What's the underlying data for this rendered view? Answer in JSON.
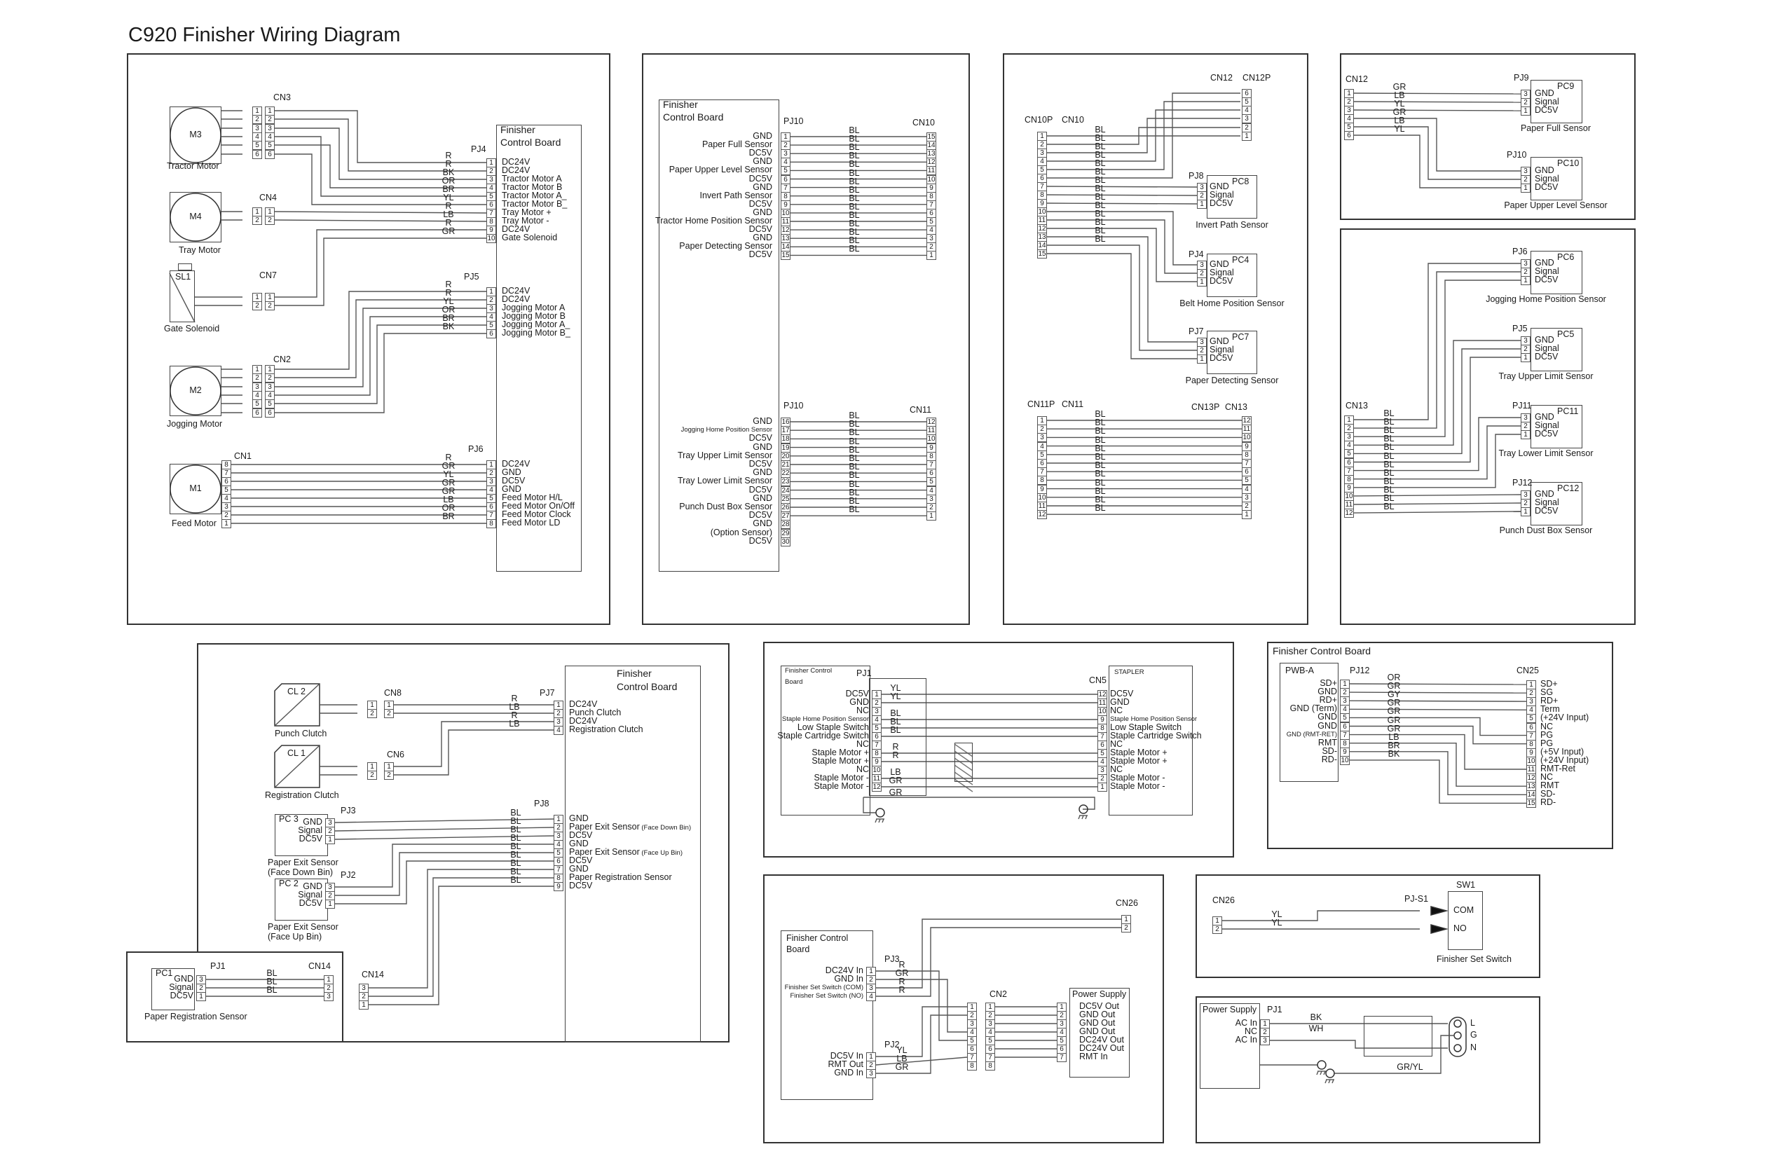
{
  "title": "C920 Finisher Wiring Diagram",
  "panel_motors": {
    "board_label": "Finisher Control Board",
    "components": [
      {
        "id": "M3",
        "name": "Tractor Motor",
        "connector": "CN3",
        "pins": 6
      },
      {
        "id": "M4",
        "name": "Tray Motor",
        "connector": "CN4",
        "pins": 2
      },
      {
        "id": "SL1",
        "name": "Gate Solenoid",
        "connector": "CN7",
        "pins": 2
      },
      {
        "id": "M2",
        "name": "Jogging Motor",
        "connector": "CN2",
        "pins": 6
      },
      {
        "id": "M1",
        "name": "Feed Motor",
        "connector": "CN1",
        "pins": 8
      }
    ],
    "pj4": {
      "label": "PJ4",
      "rows": [
        {
          "pin": "1",
          "color": "R",
          "signal": "DC24V"
        },
        {
          "pin": "2",
          "color": "R",
          "signal": "DC24V"
        },
        {
          "pin": "3",
          "color": "BK",
          "signal": "Tractor Motor A"
        },
        {
          "pin": "4",
          "color": "OR",
          "signal": "Tractor Motor B"
        },
        {
          "pin": "5",
          "color": "BR",
          "signal": "Tractor Motor A_"
        },
        {
          "pin": "6",
          "color": "YL",
          "signal": "Tractor Motor B_"
        },
        {
          "pin": "7",
          "color": "R",
          "signal": "Tray Motor +"
        },
        {
          "pin": "8",
          "color": "LB",
          "signal": "Tray Motor -"
        },
        {
          "pin": "9",
          "color": "R",
          "signal": "DC24V"
        },
        {
          "pin": "10",
          "color": "GR",
          "signal": "Gate Solenoid"
        }
      ]
    },
    "pj5": {
      "label": "PJ5",
      "rows": [
        {
          "pin": "1",
          "color": "R",
          "signal": "DC24V"
        },
        {
          "pin": "2",
          "color": "R",
          "signal": "DC24V"
        },
        {
          "pin": "3",
          "color": "YL",
          "signal": "Jogging Motor A"
        },
        {
          "pin": "4",
          "color": "OR",
          "signal": "Jogging Motor B"
        },
        {
          "pin": "5",
          "color": "BR",
          "signal": "Jogging Motor A_"
        },
        {
          "pin": "6",
          "color": "BK",
          "signal": "Jogging Motor B_"
        }
      ]
    },
    "pj6": {
      "label": "PJ6",
      "rows": [
        {
          "pin": "1",
          "color": "R",
          "signal": "DC24V"
        },
        {
          "pin": "2",
          "color": "GR",
          "signal": "GND"
        },
        {
          "pin": "3",
          "color": "YL",
          "signal": "DC5V"
        },
        {
          "pin": "4",
          "color": "GR",
          "signal": "GND"
        },
        {
          "pin": "5",
          "color": "GR",
          "signal": "Feed Motor H/L"
        },
        {
          "pin": "6",
          "color": "LB",
          "signal": "Feed Motor On/Off"
        },
        {
          "pin": "7",
          "color": "OR",
          "signal": "Feed Motor Clock"
        },
        {
          "pin": "8",
          "color": "BR",
          "signal": "Feed Motor LD"
        }
      ]
    }
  },
  "panel_pj10": {
    "board_label": "Finisher Control Board",
    "upper": {
      "pj": "PJ10",
      "cn": "CN10",
      "rows": [
        {
          "pin": "1",
          "signal": "GND",
          "color": "BL",
          "cn_pin": "15"
        },
        {
          "pin": "2",
          "signal": "Paper Full Sensor",
          "color": "BL",
          "cn_pin": "14"
        },
        {
          "pin": "3",
          "signal": "DC5V",
          "color": "BL",
          "cn_pin": "13"
        },
        {
          "pin": "4",
          "signal": "GND",
          "color": "BL",
          "cn_pin": "12"
        },
        {
          "pin": "5",
          "signal": "Paper Upper Level Sensor",
          "color": "BL",
          "cn_pin": "11"
        },
        {
          "pin": "6",
          "signal": "DC5V",
          "color": "BL",
          "cn_pin": "10"
        },
        {
          "pin": "7",
          "signal": "GND",
          "color": "BL",
          "cn_pin": "9"
        },
        {
          "pin": "8",
          "signal": "Invert Path Sensor",
          "color": "BL",
          "cn_pin": "8"
        },
        {
          "pin": "9",
          "signal": "DC5V",
          "color": "BL",
          "cn_pin": "7"
        },
        {
          "pin": "10",
          "signal": "GND",
          "color": "BL",
          "cn_pin": "6"
        },
        {
          "pin": "11",
          "signal": "Tractor Home Position Sensor",
          "color": "BL",
          "cn_pin": "5"
        },
        {
          "pin": "12",
          "signal": "DC5V",
          "color": "BL",
          "cn_pin": "4"
        },
        {
          "pin": "13",
          "signal": "GND",
          "color": "BL",
          "cn_pin": "3"
        },
        {
          "pin": "14",
          "signal": "Paper Detecting Sensor",
          "color": "BL",
          "cn_pin": "2"
        },
        {
          "pin": "15",
          "signal": "DC5V",
          "color": "BL",
          "cn_pin": "1"
        }
      ]
    },
    "lower": {
      "pj": "PJ10",
      "cn": "CN11",
      "rows": [
        {
          "pin": "16",
          "signal": "GND",
          "color": "BL",
          "cn_pin": "12"
        },
        {
          "pin": "17",
          "signal": "Jogging Home Position Sensor",
          "color": "BL",
          "cn_pin": "11"
        },
        {
          "pin": "18",
          "signal": "DC5V",
          "color": "BL",
          "cn_pin": "10"
        },
        {
          "pin": "19",
          "signal": "GND",
          "color": "BL",
          "cn_pin": "9"
        },
        {
          "pin": "20",
          "signal": "Tray Upper Limit Sensor",
          "color": "BL",
          "cn_pin": "8"
        },
        {
          "pin": "21",
          "signal": "DC5V",
          "color": "BL",
          "cn_pin": "7"
        },
        {
          "pin": "22",
          "signal": "GND",
          "color": "BL",
          "cn_pin": "6"
        },
        {
          "pin": "23",
          "signal": "Tray Lower Limit Sensor",
          "color": "BL",
          "cn_pin": "5"
        },
        {
          "pin": "24",
          "signal": "DC5V",
          "color": "BL",
          "cn_pin": "4"
        },
        {
          "pin": "25",
          "signal": "GND",
          "color": "BL",
          "cn_pin": "3"
        },
        {
          "pin": "26",
          "signal": "Punch Dust Box Sensor",
          "color": "BL",
          "cn_pin": "2"
        },
        {
          "pin": "27",
          "signal": "DC5V",
          "color": "BL",
          "cn_pin": "1"
        },
        {
          "pin": "28",
          "signal": "GND",
          "color": "",
          "cn_pin": ""
        },
        {
          "pin": "29",
          "signal": "(Option Sensor)",
          "color": "",
          "cn_pin": ""
        },
        {
          "pin": "30",
          "signal": "DC5V",
          "color": "",
          "cn_pin": ""
        }
      ]
    }
  },
  "panel_cn10": {
    "labels": [
      "CN10P",
      "CN10",
      "CN12",
      "CN12P",
      "CN11P",
      "CN11",
      "CN13P",
      "CN13"
    ],
    "wire_color": "BL",
    "sensors": [
      {
        "pj": "PJ8",
        "pc": "PC8",
        "name": "Invert Path Sensor"
      },
      {
        "pj": "PJ4",
        "pc": "PC4",
        "name": "Belt Home Position Sensor"
      },
      {
        "pj": "PJ7",
        "pc": "PC7",
        "name": "Paper Detecting Sensor"
      }
    ],
    "sensor_pins": [
      "GND",
      "Signal",
      "DC5V"
    ]
  },
  "panel_cn12": {
    "cn": "CN12",
    "colors": [
      "GR",
      "LB",
      "YL",
      "GR",
      "LB",
      "YL"
    ],
    "sensors": [
      {
        "pj": "PJ9",
        "pc": "PC9",
        "name": "Paper Full Sensor"
      },
      {
        "pj": "PJ10",
        "pc": "PC10",
        "name": "Paper Upper Level Sensor"
      }
    ]
  },
  "panel_cn13": {
    "cn": "CN13",
    "wire_color": "BL",
    "sensors": [
      {
        "pj": "PJ6",
        "pc": "PC6",
        "name": "Jogging Home Position Sensor"
      },
      {
        "pj": "PJ5",
        "pc": "PC5",
        "name": "Tray Upper Limit Sensor"
      },
      {
        "pj": "PJ11",
        "pc": "PC11",
        "name": "Tray Lower Limit Sensor"
      },
      {
        "pj": "PJ12",
        "pc": "PC12",
        "name": "Punch Dust Box Sensor"
      }
    ]
  },
  "panel_clutch": {
    "board_label_1": "Finisher",
    "board_label_2": "Control Board",
    "clutches": [
      {
        "id": "CL 2",
        "name": "Punch Clutch",
        "cn": "CN8"
      },
      {
        "id": "CL 1",
        "name": "Registration Clutch",
        "cn": "CN6"
      }
    ],
    "pj7": {
      "label": "PJ7",
      "rows": [
        {
          "pin": "1",
          "color": "R",
          "signal": "DC24V"
        },
        {
          "pin": "2",
          "color": "LB",
          "signal": "Punch Clutch"
        },
        {
          "pin": "3",
          "color": "R",
          "signal": "DC24V"
        },
        {
          "pin": "4",
          "color": "LB",
          "signal": "Registration Clutch"
        }
      ]
    },
    "pj8": {
      "label": "PJ8",
      "rows": [
        {
          "pin": "1",
          "color": "BL",
          "signal": "GND",
          "note": ""
        },
        {
          "pin": "2",
          "color": "BL",
          "signal": "Paper Exit Sensor",
          "note": "(Face Down Bin)"
        },
        {
          "pin": "3",
          "color": "BL",
          "signal": "DC5V",
          "note": ""
        },
        {
          "pin": "4",
          "color": "BL",
          "signal": "GND",
          "note": ""
        },
        {
          "pin": "5",
          "color": "BL",
          "signal": "Paper Exit Sensor",
          "note": "(Face Up Bin)"
        },
        {
          "pin": "6",
          "color": "BL",
          "signal": "DC5V",
          "note": ""
        },
        {
          "pin": "7",
          "color": "BL",
          "signal": "GND",
          "note": ""
        },
        {
          "pin": "8",
          "color": "BL",
          "signal": "Paper Registration Sensor",
          "note": ""
        },
        {
          "pin": "9",
          "color": "BL",
          "signal": "DC5V",
          "note": ""
        }
      ]
    },
    "sensors": [
      {
        "pc": "PC 3",
        "pj": "PJ3",
        "name1": "Paper Exit Sensor",
        "name2": "(Face Down Bin)"
      },
      {
        "pc": "PC 2",
        "pj": "PJ2",
        "name1": "Paper Exit Sensor",
        "name2": "(Face Up Bin)"
      }
    ],
    "sensor_pins": [
      {
        "n": "3",
        "l": "GND"
      },
      {
        "n": "2",
        "l": "Signal"
      },
      {
        "n": "1",
        "l": "DC5V"
      }
    ],
    "cn14": "CN14"
  },
  "panel_pc1": {
    "pc": "PC1",
    "pj": "PJ1",
    "cn": "CN14",
    "name": "Paper Registration Sensor",
    "rows": [
      {
        "pin": "3",
        "signal": "GND",
        "color": "BL",
        "cn_pin": "1"
      },
      {
        "pin": "2",
        "signal": "Signal",
        "color": "BL",
        "cn_pin": "2"
      },
      {
        "pin": "1",
        "signal": "DC5V",
        "color": "BL",
        "cn_pin": "3"
      }
    ]
  },
  "panel_stapler": {
    "board_label_1": "Finisher Control",
    "board_label_2": "Board",
    "pj": "PJ1",
    "cn": "CN5",
    "stapler": "STAPLER",
    "rows": [
      {
        "pin": "1",
        "signal": "DC5V",
        "color": "YL",
        "cn_pin": "12",
        "cn_signal": "DC5V"
      },
      {
        "pin": "2",
        "signal": "GND",
        "color": "YL",
        "cn_pin": "11",
        "cn_signal": "GND"
      },
      {
        "pin": "3",
        "signal": "NC",
        "color": "",
        "cn_pin": "10",
        "cn_signal": "NC"
      },
      {
        "pin": "4",
        "signal": "Staple Home Position Sensor",
        "color": "BL",
        "cn_pin": "9",
        "cn_signal": "Staple Home Position Sensor"
      },
      {
        "pin": "5",
        "signal": "Low Staple Switch",
        "color": "BL",
        "cn_pin": "8",
        "cn_signal": "Low Staple Switch"
      },
      {
        "pin": "6",
        "signal": "Staple Cartridge Switch",
        "color": "BL",
        "cn_pin": "7",
        "cn_signal": "Staple Cartridge Switch"
      },
      {
        "pin": "7",
        "signal": "NC",
        "color": "",
        "cn_pin": "6",
        "cn_signal": "NC"
      },
      {
        "pin": "8",
        "signal": "Staple Motor +",
        "color": "R",
        "cn_pin": "5",
        "cn_signal": "Staple Motor +"
      },
      {
        "pin": "9",
        "signal": "Staple Motor +",
        "color": "R",
        "cn_pin": "4",
        "cn_signal": "Staple Motor +"
      },
      {
        "pin": "10",
        "signal": "NC",
        "color": "",
        "cn_pin": "3",
        "cn_signal": "NC"
      },
      {
        "pin": "11",
        "signal": "Staple Motor -",
        "color": "LB",
        "cn_pin": "2",
        "cn_signal": "Staple Motor -"
      },
      {
        "pin": "12",
        "signal": "Staple Motor -",
        "color": "GR",
        "cn_pin": "1",
        "cn_signal": "Staple Motor -"
      }
    ],
    "ground_color": "GR"
  },
  "panel_pwba": {
    "title": "Finisher Control Board",
    "board": "PWB-A",
    "pj": "PJ12",
    "cn": "CN25",
    "left": [
      {
        "pin": "1",
        "signal": "SD+",
        "color": "OR"
      },
      {
        "pin": "2",
        "signal": "GND",
        "color": "GR"
      },
      {
        "pin": "3",
        "signal": "RD+",
        "color": "GY"
      },
      {
        "pin": "4",
        "signal": "GND (Term)",
        "color": "GR"
      },
      {
        "pin": "5",
        "signal": "GND",
        "color": "GR"
      },
      {
        "pin": "6",
        "signal": "GND",
        "color": "GR"
      },
      {
        "pin": "7",
        "signal": "GND (RMT-RET)",
        "color": "GR"
      },
      {
        "pin": "8",
        "signal": "RMT",
        "color": "LB"
      },
      {
        "pin": "9",
        "signal": "SD-",
        "color": "BR"
      },
      {
        "pin": "10",
        "signal": "RD-",
        "color": "BK"
      }
    ],
    "right": [
      {
        "pin": "1",
        "signal": "SD+"
      },
      {
        "pin": "2",
        "signal": "SG"
      },
      {
        "pin": "3",
        "signal": "RD+"
      },
      {
        "pin": "4",
        "signal": "Term"
      },
      {
        "pin": "5",
        "signal": "(+24V Input)"
      },
      {
        "pin": "6",
        "signal": "NC"
      },
      {
        "pin": "7",
        "signal": "PG"
      },
      {
        "pin": "8",
        "signal": "PG"
      },
      {
        "pin": "9",
        "signal": "(+5V Input)"
      },
      {
        "pin": "10",
        "signal": "(+24V Input)"
      },
      {
        "pin": "11",
        "signal": "RMT-Ret"
      },
      {
        "pin": "12",
        "signal": "NC"
      },
      {
        "pin": "13",
        "signal": "RMT"
      },
      {
        "pin": "14",
        "signal": "SD-"
      },
      {
        "pin": "15",
        "signal": "RD-"
      }
    ]
  },
  "panel_power": {
    "board_label_1": "Finisher Control",
    "board_label_2": "Board",
    "pj3": {
      "label": "PJ3",
      "rows": [
        {
          "pin": "1",
          "signal": "DC24V In",
          "color": "R"
        },
        {
          "pin": "2",
          "signal": "GND In",
          "color": "GR"
        },
        {
          "pin": "3",
          "signal": "Finisher Set Switch (COM)",
          "color": "R"
        },
        {
          "pin": "4",
          "signal": "Finisher Set Switch (NO)",
          "color": "R"
        }
      ]
    },
    "pj2": {
      "label": "PJ2",
      "rows": [
        {
          "pin": "1",
          "signal": "DC5V In",
          "color": "YL"
        },
        {
          "pin": "2",
          "signal": "RMT Out",
          "color": "LB"
        },
        {
          "pin": "3",
          "signal": "GND In",
          "color": "GR"
        }
      ]
    },
    "cn26": "CN26",
    "cn2": "CN2",
    "power_supply": "Power Supply",
    "ps_rows": [
      {
        "pin": "1",
        "signal": "DC5V Out"
      },
      {
        "pin": "2",
        "signal": "GND Out"
      },
      {
        "pin": "3",
        "signal": "GND Out"
      },
      {
        "pin": "4",
        "signal": "GND Out"
      },
      {
        "pin": "5",
        "signal": "DC24V Out"
      },
      {
        "pin": "6",
        "signal": "DC24V Out"
      },
      {
        "pin": "7",
        "signal": "RMT In"
      }
    ]
  },
  "panel_switch": {
    "cn": "CN26",
    "pj": "PJ-S1",
    "sw": "SW1",
    "colors": [
      "YL",
      "YL"
    ],
    "contacts": [
      "COM",
      "NO"
    ],
    "name": "Finisher Set Switch"
  },
  "panel_ac": {
    "label": "Power Supply",
    "pj": "PJ1",
    "rows": [
      {
        "pin": "1",
        "signal": "AC In",
        "color": "BK"
      },
      {
        "pin": "2",
        "signal": "NC",
        "color": ""
      },
      {
        "pin": "3",
        "signal": "AC In",
        "color": "WH"
      }
    ],
    "ground_color": "GR/YL",
    "plug": [
      "L",
      "G",
      "N"
    ]
  }
}
